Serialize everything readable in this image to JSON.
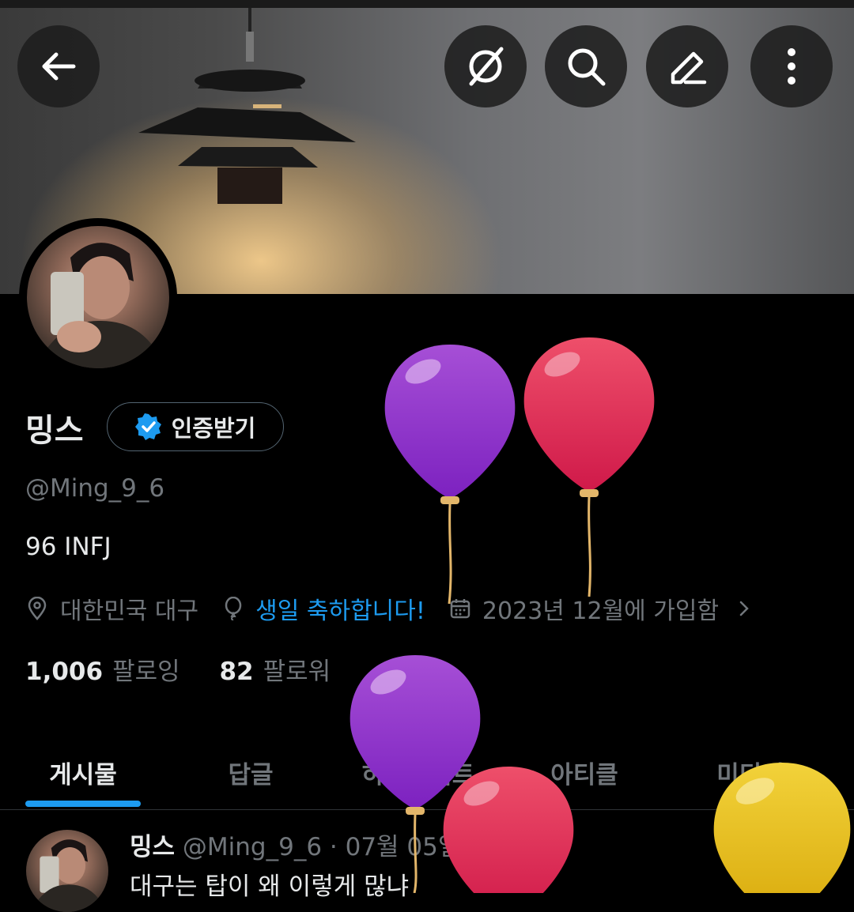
{
  "profile": {
    "name": "밍스",
    "verify_label": "인증받기",
    "handle": "@Ming_9_6",
    "bio": "96 INFJ",
    "location": "대한민국 대구",
    "birthday": "생일 축하합니다!",
    "joined": "2023년 12월에 가입함",
    "following_count": "1,006",
    "following_label": "팔로잉",
    "followers_count": "82",
    "followers_label": "팔로워"
  },
  "tabs": [
    {
      "label": "게시물",
      "active": true
    },
    {
      "label": "답글",
      "active": false
    },
    {
      "label": "하이라이트",
      "active": false
    },
    {
      "label": "아티클",
      "active": false
    },
    {
      "label": "미디어",
      "active": false
    }
  ],
  "post": {
    "name": "밍스",
    "handle_date": "@Ming_9_6 · 07월 05일",
    "text": "대구는 탑이 왜 이렇게 많냐"
  },
  "icons": {
    "back": "back-arrow-icon",
    "grok": "grok-icon",
    "search": "search-icon",
    "edit": "edit-icon",
    "more": "more-vertical-icon",
    "verified": "verified-badge-icon",
    "location": "location-pin-icon",
    "birthday": "balloon-icon",
    "calendar": "calendar-icon"
  },
  "colors": {
    "accent": "#1d9bf0",
    "muted": "#71767b",
    "text": "#e7e9ea",
    "background": "#000000"
  }
}
